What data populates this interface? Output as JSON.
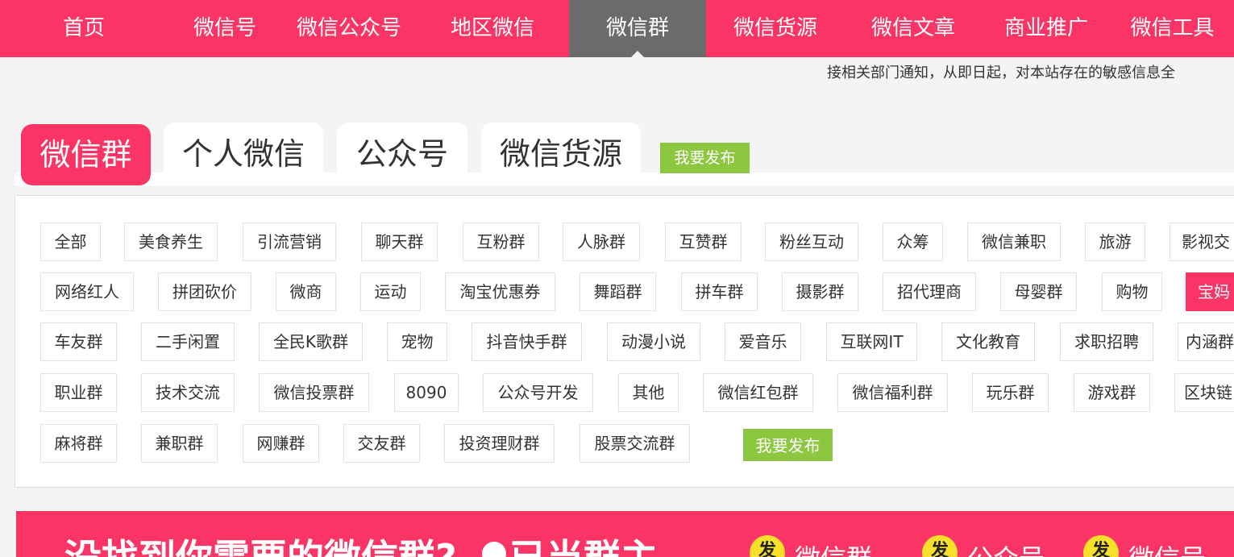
{
  "topnav": {
    "items": [
      {
        "label": "首页"
      },
      {
        "label": "微信号"
      },
      {
        "label": "微信公众号"
      },
      {
        "label": "地区微信"
      },
      {
        "label": "微信群"
      },
      {
        "label": "微信货源"
      },
      {
        "label": "微信文章"
      },
      {
        "label": "商业推广"
      },
      {
        "label": "微信工具"
      }
    ],
    "active": "微信群"
  },
  "notice": "接相关部门通知，从即日起，对本站存在的敏感信息全",
  "tabs": {
    "items": [
      {
        "label": "微信群"
      },
      {
        "label": "个人微信"
      },
      {
        "label": "公众号"
      },
      {
        "label": "微信货源"
      }
    ],
    "post_label": "我要发布"
  },
  "tags": {
    "row1": [
      "全部",
      "美食养生",
      "引流营销",
      "聊天群",
      "互粉群",
      "人脉群",
      "互赞群",
      "粉丝互动",
      "众筹",
      "微信兼职",
      "旅游",
      "影视交"
    ],
    "row2": [
      "网络红人",
      "拼团砍价",
      "微商",
      "运动",
      "淘宝优惠券",
      "舞蹈群",
      "拼车群",
      "摄影群",
      "招代理商",
      "母婴群",
      "购物",
      "宝妈"
    ],
    "row3": [
      "车友群",
      "二手闲置",
      "全民K歌群",
      "宠物",
      "抖音快手群",
      "动漫小说",
      "爱音乐",
      "互联网IT",
      "文化教育",
      "求职招聘",
      "内涵群"
    ],
    "row4": [
      "职业群",
      "技术交流",
      "微信投票群",
      "8090",
      "公众号开发",
      "其他",
      "微信红包群",
      "微信福利群",
      "玩乐群",
      "游戏群",
      "区块链"
    ],
    "row5": [
      "麻将群",
      "兼职群",
      "网赚群",
      "交友群",
      "投资理财群",
      "股票交流群"
    ],
    "post_label": "我要发布"
  },
  "banner": {
    "text": "没找到你需要的微信群?",
    "text2": "已当群主",
    "badge_text": "发",
    "items": [
      {
        "label": "微信群"
      },
      {
        "label": "公众号"
      },
      {
        "label": "微信号"
      }
    ]
  },
  "colors": {
    "brand": "#fa3566",
    "active_nav": "#6b6b6b",
    "post_button": "#8dc63f",
    "badge": "#f7e02a"
  }
}
